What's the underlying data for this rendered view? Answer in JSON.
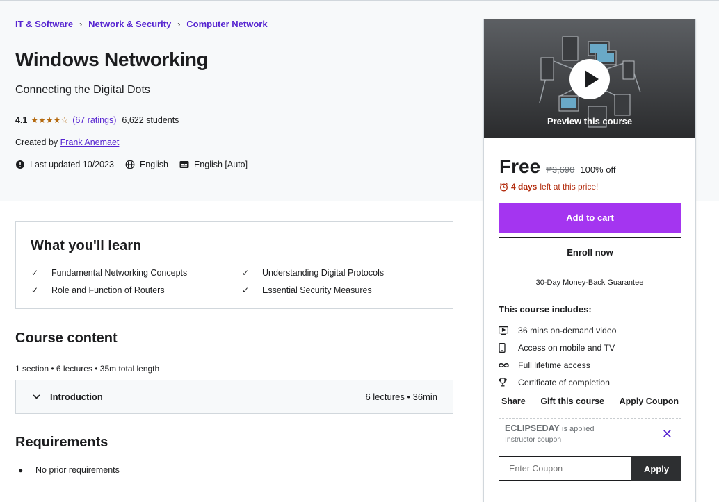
{
  "breadcrumb": [
    "IT & Software",
    "Network & Security",
    "Computer Network"
  ],
  "course": {
    "title": "Windows Networking",
    "subtitle": "Connecting the Digital Dots",
    "rating": "4.1",
    "stars": "★★★★☆",
    "ratings_count": "(67 ratings)",
    "students": "6,622 students",
    "created_by_label": "Created by",
    "instructor": "Frank Anemaet",
    "last_updated": "Last updated 10/2023",
    "language": "English",
    "captions": "English [Auto]"
  },
  "sidebar": {
    "preview_label": "Preview this course",
    "price": "Free",
    "original_price": "₱3,690",
    "discount": "100% off",
    "timer_days": "4 days",
    "timer_rest": "left at this price!",
    "add_to_cart": "Add to cart",
    "enroll_now": "Enroll now",
    "guarantee": "30-Day Money-Back Guarantee",
    "includes_title": "This course includes:",
    "includes": [
      {
        "icon": "video-icon",
        "label": "36 mins on-demand video"
      },
      {
        "icon": "mobile-icon",
        "label": "Access on mobile and TV"
      },
      {
        "icon": "infinity-icon",
        "label": "Full lifetime access"
      },
      {
        "icon": "trophy-icon",
        "label": "Certificate of completion"
      }
    ],
    "links": {
      "share": "Share",
      "gift": "Gift this course",
      "apply_coupon": "Apply Coupon"
    },
    "coupon": {
      "code": "ECLIPSEDAY",
      "applied": "is applied",
      "type": "Instructor coupon"
    },
    "coupon_placeholder": "Enter Coupon",
    "apply_button": "Apply"
  },
  "learn": {
    "title": "What you'll learn",
    "items": [
      "Fundamental Networking Concepts",
      "Understanding Digital Protocols",
      "Role and Function of Routers",
      "Essential Security Measures"
    ]
  },
  "content": {
    "title": "Course content",
    "meta": "1 section • 6 lectures • 35m total length",
    "sections": [
      {
        "title": "Introduction",
        "meta": "6 lectures • 36min"
      }
    ]
  },
  "requirements": {
    "title": "Requirements",
    "items": [
      "No prior requirements"
    ]
  },
  "colors": {
    "brand_purple": "#a435f0",
    "link_purple": "#5624d0",
    "star": "#b4690e",
    "urgent": "#b32d0f"
  }
}
